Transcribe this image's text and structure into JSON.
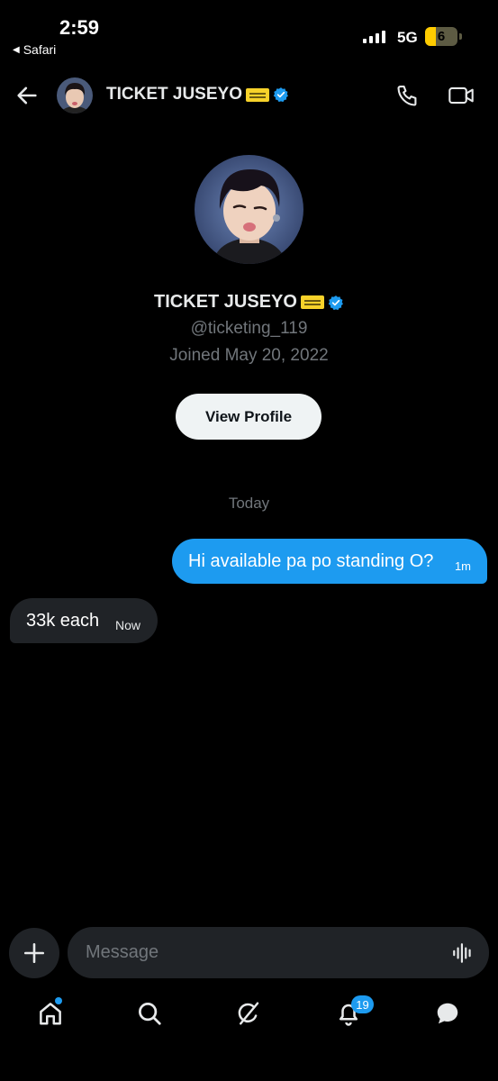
{
  "status_bar": {
    "time": "2:59",
    "back_app": "Safari",
    "network": "5G",
    "battery": "6"
  },
  "header": {
    "name": "TICKET JUSEYO",
    "back_icon": "arrow-left-icon",
    "call_icon": "phone-icon",
    "video_icon": "video-camera-icon"
  },
  "profile": {
    "name": "TICKET JUSEYO",
    "handle": "@ticketing_119",
    "joined": "Joined May 20, 2022",
    "view_profile_label": "View Profile"
  },
  "conversation": {
    "day_separator": "Today",
    "messages": [
      {
        "direction": "outgoing",
        "text": "Hi available pa po standing O?",
        "time": "1m"
      },
      {
        "direction": "incoming",
        "text": "33k each",
        "time": "Now"
      }
    ]
  },
  "composer": {
    "placeholder": "Message"
  },
  "tabbar": {
    "notifications_badge": "19"
  },
  "colors": {
    "accent": "#1d9bf0",
    "background": "#000000",
    "bubble_incoming": "#202327"
  }
}
